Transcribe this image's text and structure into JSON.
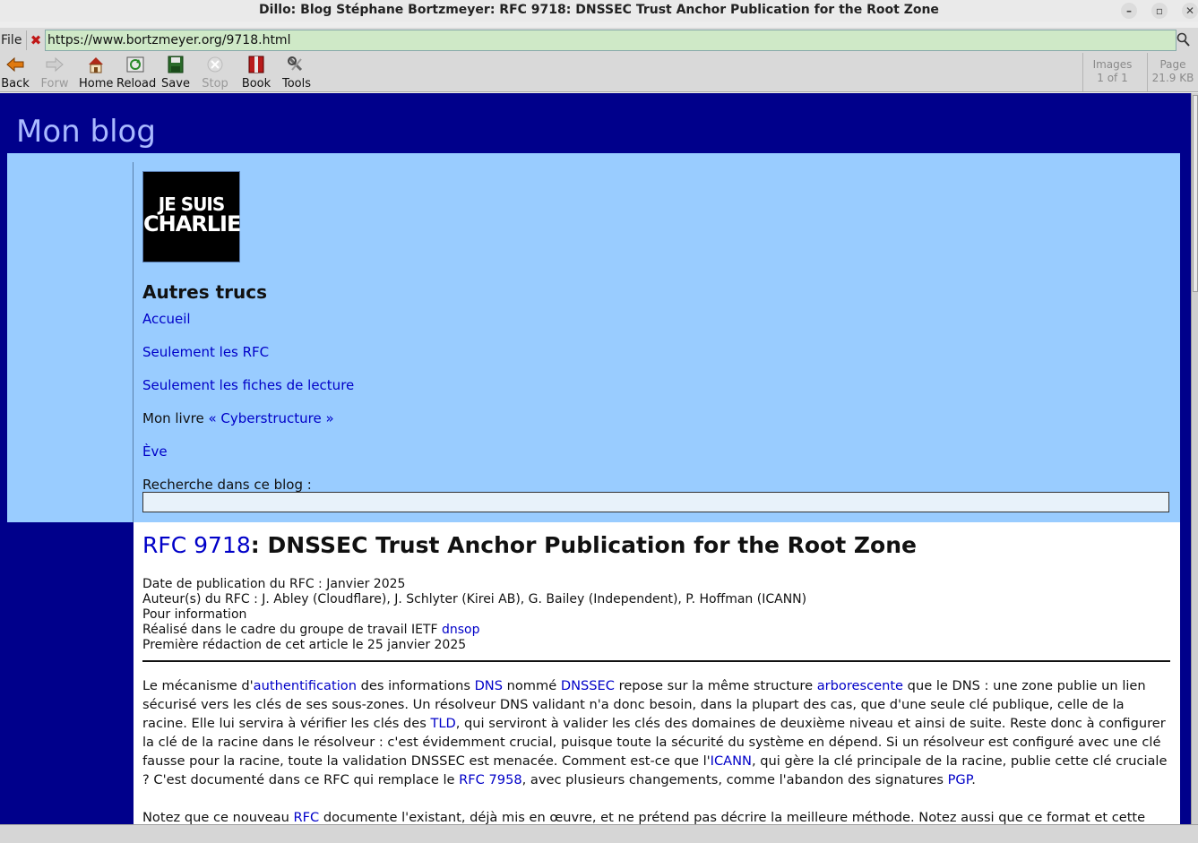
{
  "window": {
    "title": "Dillo: Blog Stéphane Bortzmeyer: RFC 9718: DNSSEC Trust Anchor Publication for the Root Zone"
  },
  "urlbar": {
    "file_label": "File",
    "url": "https://www.bortzmeyer.org/9718.html"
  },
  "toolbar": {
    "back": "Back",
    "forward": "Forw",
    "home": "Home",
    "reload": "Reload",
    "save": "Save",
    "stop": "Stop",
    "book": "Book",
    "tools": "Tools",
    "images_label": "Images",
    "images_value": "1 of 1",
    "page_label": "Page",
    "page_value": "21.9 KB"
  },
  "site": {
    "title": "Mon blog"
  },
  "sidebar": {
    "logo_line1": "JE SUIS",
    "logo_line2": "CHARLIE",
    "heading": "Autres trucs",
    "links": [
      "Accueil",
      "Seulement les RFC",
      "Seulement les fiches de lecture"
    ],
    "book_prefix": "Mon livre",
    "book_link": "« Cyberstructure »",
    "eve_link": "Ève",
    "search_label": "Recherche dans ce blog :"
  },
  "article": {
    "rfc_link": "RFC 9718",
    "title_rest": ": DNSSEC Trust Anchor Publication for the Root Zone",
    "meta_date": "Date de publication du RFC : Janvier 2025",
    "meta_authors": "Auteur(s) du RFC : J. Abley (Cloudflare), J. Schlyter (Kirei AB), G. Bailey (Independent), P. Hoffman (ICANN)",
    "meta_status": "Pour information",
    "meta_wg_prefix": "Réalisé dans le cadre du groupe de travail IETF",
    "meta_wg_link": "dnsop",
    "meta_first": "Première rédaction de cet article le 25 janvier 2025",
    "p1": [
      {
        "t": "Le mécanisme d'"
      },
      {
        "t": "authentification",
        "l": true
      },
      {
        "t": " des informations "
      },
      {
        "t": "DNS",
        "l": true
      },
      {
        "t": " nommé "
      },
      {
        "t": "DNSSEC",
        "l": true
      },
      {
        "t": " repose sur la même structure "
      },
      {
        "t": "arborescente",
        "l": true
      },
      {
        "t": " que le DNS : une zone publie un lien sécurisé vers les clés de ses sous-zones. Un résolveur DNS validant n'a donc besoin, dans la plupart des cas, que d'une seule clé publique, celle de la racine. Elle lui servira à vérifier les clés des "
      },
      {
        "t": "TLD",
        "l": true
      },
      {
        "t": ", qui serviront à valider les clés des domaines de deuxième niveau et ainsi de suite. Reste donc à configurer la clé de la racine dans le résolveur : c'est évidemment crucial, puisque toute la sécurité du système en dépend. Si un résolveur est configuré avec une clé fausse pour la racine, toute la validation DNSSEC est menacée. Comment est-ce que l'"
      },
      {
        "t": "ICANN",
        "l": true
      },
      {
        "t": ", qui gère la clé principale de la racine, publie cette clé cruciale ? C'est documenté dans ce RFC qui remplace le "
      },
      {
        "t": "RFC 7958",
        "l": true
      },
      {
        "t": ", avec plusieurs changements, comme l'abandon des signatures "
      },
      {
        "t": "PGP",
        "l": true
      },
      {
        "t": "."
      }
    ],
    "p2": [
      {
        "t": "Notez que ce nouveau "
      },
      {
        "t": "RFC",
        "l": true
      },
      {
        "t": " documente l'existant, déjà mis en œuvre, et ne prétend pas décrire la meilleure méthode. Notez aussi que ce format et cette méthode"
      }
    ]
  },
  "colors": {
    "page_bg": "#00008b",
    "sidebar_bg": "#99ccff",
    "link": "#0000c8",
    "url_bg": "#cfe9c7"
  }
}
